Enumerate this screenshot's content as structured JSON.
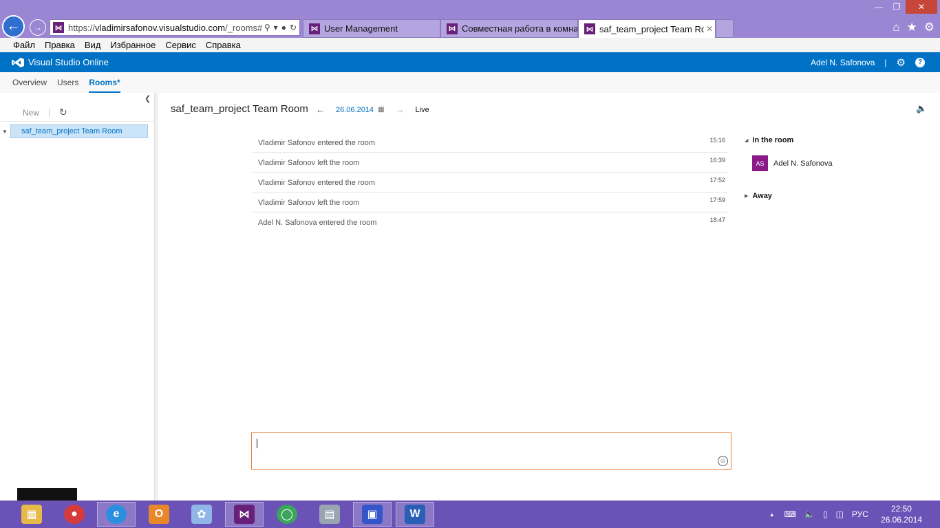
{
  "browser": {
    "url_prefix": "https://",
    "url_domain": "vladimirsafonov.visualstudio.com",
    "url_path": "/_rooms#",
    "tabs": [
      {
        "label": "User Management"
      },
      {
        "label": "Совместная работа в комнат..."
      },
      {
        "label": "saf_team_project Team Roo..."
      }
    ],
    "menu": [
      "Файл",
      "Правка",
      "Вид",
      "Избранное",
      "Сервис",
      "Справка"
    ]
  },
  "header": {
    "product": "Visual Studio Online",
    "user": "Adel N. Safonova",
    "separator": "|"
  },
  "subnav": {
    "items": [
      "Overview",
      "Users",
      "Rooms*"
    ]
  },
  "left": {
    "new_label": "New",
    "rooms": [
      "saf_team_project Team Room"
    ]
  },
  "main": {
    "title": "saf_team_project Team Room",
    "date": "26.06.2014",
    "live": "Live",
    "messages": [
      {
        "text": "Vladimir Safonov entered the room",
        "time": "15:16"
      },
      {
        "text": "Vladimir Safonov left the room",
        "time": "16:39"
      },
      {
        "text": "Vladimir Safonov entered the room",
        "time": "17:52"
      },
      {
        "text": "Vladimir Safonov left the room",
        "time": "17:59"
      },
      {
        "text": "Adel N. Safonova entered the room",
        "time": "18:47"
      }
    ]
  },
  "roster": {
    "in_room_label": "In the room",
    "members": [
      {
        "initials": "AS",
        "name": "Adel N. Safonova"
      }
    ],
    "away_label": "Away"
  },
  "taskbar": {
    "lang": "РУС",
    "time": "22:50",
    "date": "26.06.2014"
  },
  "colors": {
    "accent": "#0072c6",
    "chrome": "#9b86d3",
    "taskbar": "#6b52b7",
    "avatar": "#8b1a89",
    "composer_border": "#e8823a"
  }
}
